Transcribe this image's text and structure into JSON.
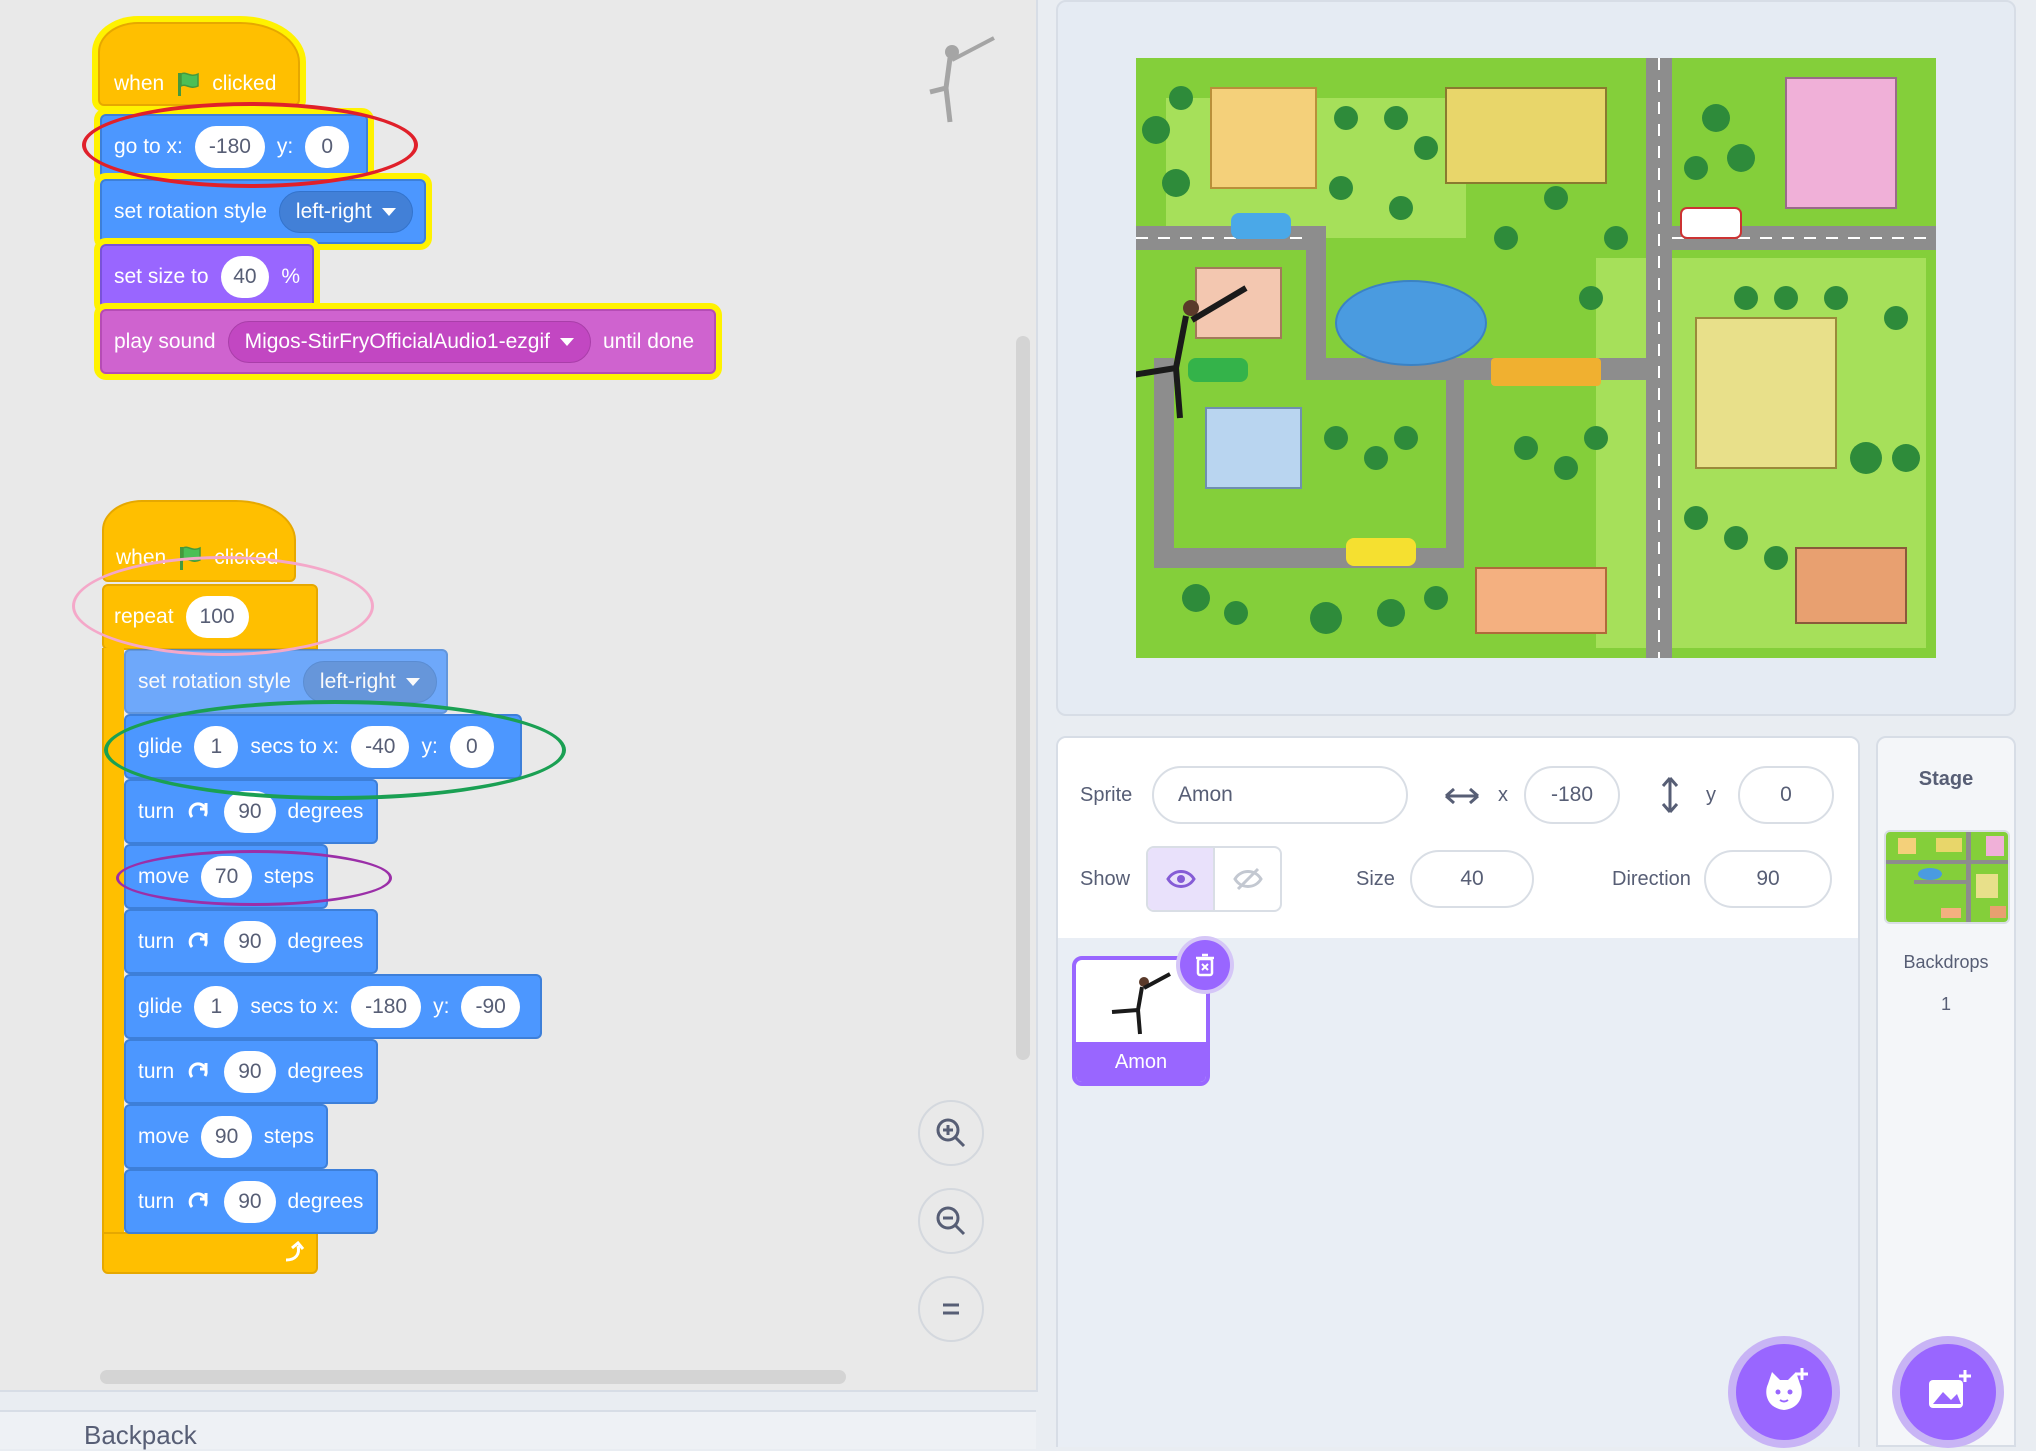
{
  "script1": {
    "hat_when": "when",
    "hat_clicked": "clicked",
    "goto_label": "go to x:",
    "goto_x": "-180",
    "goto_y_label": "y:",
    "goto_y": "0",
    "rotation_label": "set rotation style",
    "rotation_value": "left-right",
    "size_label": "set size to",
    "size_value": "40",
    "size_unit": "%",
    "sound_label": "play sound",
    "sound_value": "Migos-StirFryOfficialAudio1-ezgif",
    "sound_suffix": "until done"
  },
  "script2": {
    "hat_when": "when",
    "hat_clicked": "clicked",
    "repeat_label": "repeat",
    "repeat_value": "100",
    "rotation_label": "set rotation style",
    "rotation_value": "left-right",
    "glide1": {
      "label": "glide",
      "secs": "1",
      "mid": "secs to x:",
      "x": "-40",
      "y_label": "y:",
      "y": "0"
    },
    "turn1": {
      "label": "turn",
      "value": "90",
      "suffix": "degrees"
    },
    "move1": {
      "label": "move",
      "value": "70",
      "suffix": "steps"
    },
    "turn2": {
      "label": "turn",
      "value": "90",
      "suffix": "degrees"
    },
    "glide2": {
      "label": "glide",
      "secs": "1",
      "mid": "secs to x:",
      "x": "-180",
      "y_label": "y:",
      "y": "-90"
    },
    "turn3": {
      "label": "turn",
      "value": "90",
      "suffix": "degrees"
    },
    "move2": {
      "label": "move",
      "value": "90",
      "suffix": "steps"
    },
    "turn4": {
      "label": "turn",
      "value": "90",
      "suffix": "degrees"
    }
  },
  "backpack_label": "Backpack",
  "sprite_info": {
    "sprite_label": "Sprite",
    "sprite_name": "Amon",
    "x_label": "x",
    "x_value": "-180",
    "y_label": "y",
    "y_value": "0",
    "show_label": "Show",
    "size_label": "Size",
    "size_value": "40",
    "direction_label": "Direction",
    "direction_value": "90"
  },
  "sprite_tile": {
    "name": "Amon"
  },
  "stage_selector": {
    "title": "Stage",
    "backdrops_label": "Backdrops",
    "backdrops_count": "1"
  },
  "colors": {
    "motion": "#4c97ff",
    "looks": "#9966ff",
    "sound": "#cf63cf",
    "control": "#ffbf00",
    "highlight": "#fff200"
  }
}
